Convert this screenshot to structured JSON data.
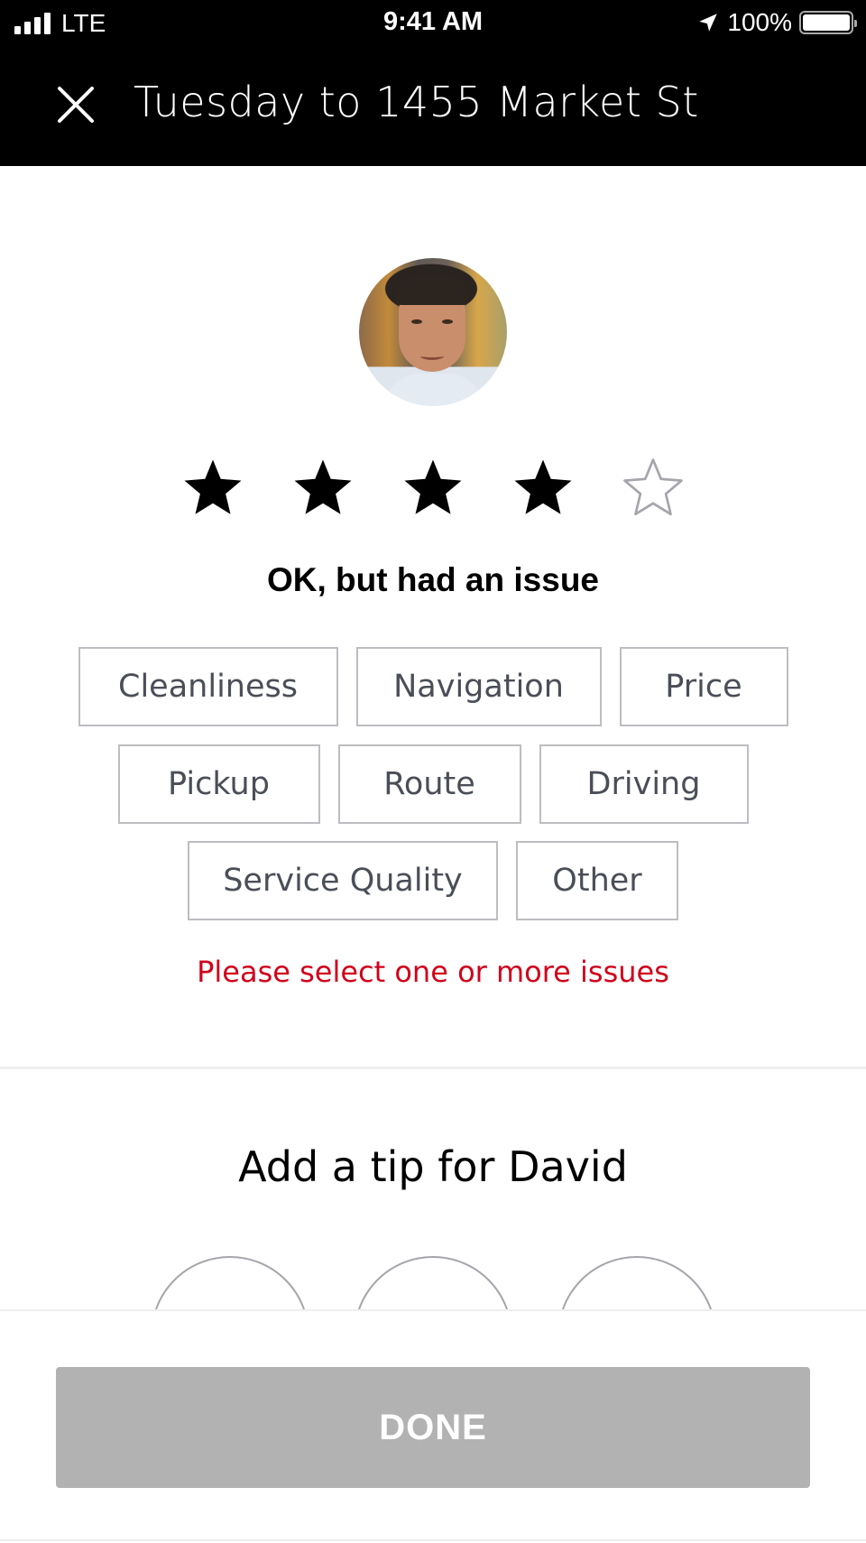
{
  "status_bar": {
    "carrier": "LTE",
    "time": "9:41 AM",
    "battery_percent": "100%",
    "icons": [
      "signal-bars-icon",
      "location-arrow-icon",
      "battery-icon"
    ]
  },
  "header": {
    "title": "Tuesday to 1455 Market St",
    "close_icon": "close-icon"
  },
  "driver": {
    "name": "David",
    "avatar": "driver-photo"
  },
  "rating": {
    "value": 4,
    "max": 5,
    "label": "OK, but had an issue"
  },
  "issues": {
    "rows": [
      [
        {
          "label": "Cleanliness"
        },
        {
          "label": "Navigation"
        },
        {
          "label": "Price"
        }
      ],
      [
        {
          "label": "Pickup"
        },
        {
          "label": "Route"
        },
        {
          "label": "Driving"
        }
      ],
      [
        {
          "label": "Service Quality"
        },
        {
          "label": "Other"
        }
      ]
    ],
    "error": "Please select one or more issues"
  },
  "tip": {
    "title": "Add a tip for David"
  },
  "footer": {
    "done_label": "DONE"
  },
  "colors": {
    "error": "#d0021b",
    "done_disabled": "#b2b2b2",
    "chip_border": "#bdbdc2",
    "chip_text": "#4a4e57"
  }
}
